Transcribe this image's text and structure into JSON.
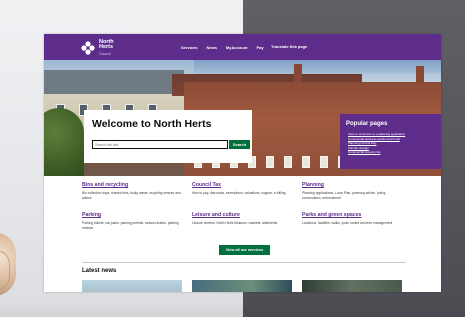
{
  "site": {
    "logo_line1": "North",
    "logo_line2": "Herts",
    "logo_line3": "Council"
  },
  "header": {
    "nav": [
      "Services",
      "News",
      "MyAccount",
      "Pay"
    ],
    "translate": "Translate this page"
  },
  "hero": {
    "welcome_title": "Welcome to North Herts",
    "search_placeholder": "Search the site",
    "search_button": "Search"
  },
  "popular": {
    "title": "Popular pages",
    "links": [
      "View or comment on a planning application",
      "Commercial business grants and funds",
      "Planning Control Day",
      "Climate change",
      "Commercial property list"
    ]
  },
  "services": [
    {
      "title": "Bins and recycling",
      "desc": "Bin collection days, missed bins, bulky waste, recycling centres and advice"
    },
    {
      "title": "Council Tax",
      "desc": "How to pay, discounts, exemptions, valuations, support, e-billing"
    },
    {
      "title": "Planning",
      "desc": "Planning applications, Local Plan, planning advice, policy, conservation, enforcement"
    },
    {
      "title": "Parking",
      "desc": "Parking tickets, car parks, parking permits, season tickets, parking reviews"
    },
    {
      "title": "Leisure and culture",
      "desc": "Leisure centres, North Herts Museum, markets, allotments"
    },
    {
      "title": "Parks and green spaces",
      "desc": "Locations, facilities, walks, cycle routes and tree management"
    }
  ],
  "all_services_button": "View all our services",
  "latest_news": "Latest news",
  "colors": {
    "brand_purple": "#5e2d8c",
    "action_green": "#00703c"
  }
}
